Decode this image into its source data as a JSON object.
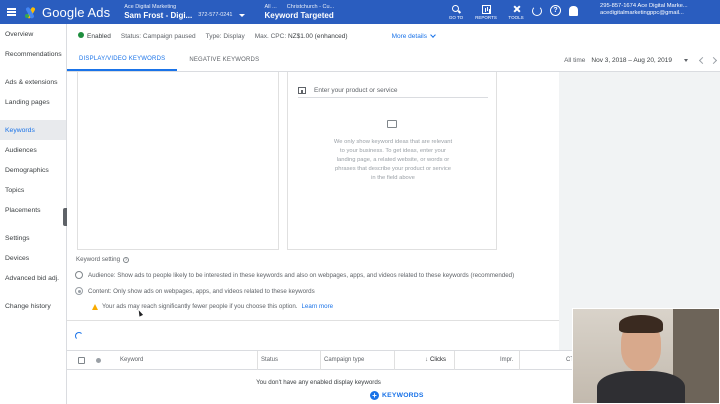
{
  "topbar": {
    "logo_text": "Google Ads",
    "account_small": "Ace Digital Marketing",
    "account_name": "Sam Frost - Digi...",
    "account_id": "372-577-0241",
    "breadcrumb_all": "All ...",
    "breadcrumb_campaign": "Christchurch - Cu...",
    "breadcrumb_title": "Keyword Targeted",
    "tools": [
      {
        "label": "GO TO",
        "icon": "search-icon"
      },
      {
        "label": "REPORTS",
        "icon": "reports-icon"
      },
      {
        "label": "TOOLS",
        "icon": "tools-icon"
      }
    ],
    "help_glyph": "?",
    "user_line1": "295-857-1674 Ace Digital Marke...",
    "user_line2": "acedigitalmarketingppc@gmail..."
  },
  "nav": {
    "items": [
      {
        "label": "Overview",
        "active": false
      },
      {
        "label": "Recommendations",
        "active": false
      },
      {
        "label": "Ads & extensions",
        "active": false
      },
      {
        "label": "Landing pages",
        "active": false
      },
      {
        "label": "Keywords",
        "active": true
      },
      {
        "label": "Audiences",
        "active": false
      },
      {
        "label": "Demographics",
        "active": false
      },
      {
        "label": "Topics",
        "active": false
      },
      {
        "label": "Placements",
        "active": false
      },
      {
        "label": "Settings",
        "active": false
      },
      {
        "label": "Devices",
        "active": false
      },
      {
        "label": "Advanced bid adj.",
        "active": false
      },
      {
        "label": "Change history",
        "active": false
      }
    ]
  },
  "status": {
    "enabled": "Enabled",
    "status_label": "Status:",
    "status_value": "Campaign paused",
    "type_label": "Type:",
    "type_value": "Display",
    "cpc_label": "Max. CPC:",
    "cpc_value": "NZ$1.00 (enhanced)",
    "more_details": "More details"
  },
  "tabs": {
    "display_video": "DISPLAY/VIDEO KEYWORDS",
    "negative": "NEGATIVE KEYWORDS"
  },
  "daterange": {
    "label": "All time",
    "value": "Nov 3, 2018 – Aug 20, 2019"
  },
  "ideas": {
    "placeholder": "Enter your product or service",
    "empty_message": "We only show keyword ideas that are relevant to your business. To get ideas, enter your landing page, a related website, or words or phrases that describe your product or service in the field above"
  },
  "keyword_setting": {
    "title": "Keyword setting",
    "audience_option": "Audience: Show ads to people likely to be interested in these keywords and also on webpages, apps, and videos related to these keywords (recommended)",
    "content_option": "Content: Only show ads on webpages, apps, and videos related to these keywords",
    "warning": "Your ads may reach significantly fewer people if you choose this option.",
    "learn_more": "Learn more"
  },
  "table": {
    "columns": {
      "keyword": "Keyword",
      "status": "Status",
      "campaign_type": "Campaign type",
      "clicks": "Clicks",
      "impr": "Impr.",
      "ctr": "CT"
    },
    "sort_glyph": "↓",
    "empty": "You don't have any enabled display keywords",
    "add_label": "KEYWORDS",
    "add_glyph": "+"
  },
  "colors": {
    "topbar": "#2a5dbf",
    "accent": "#1a73e8",
    "enabled_green": "#1e8e3e",
    "warning": "#f9ab00"
  }
}
